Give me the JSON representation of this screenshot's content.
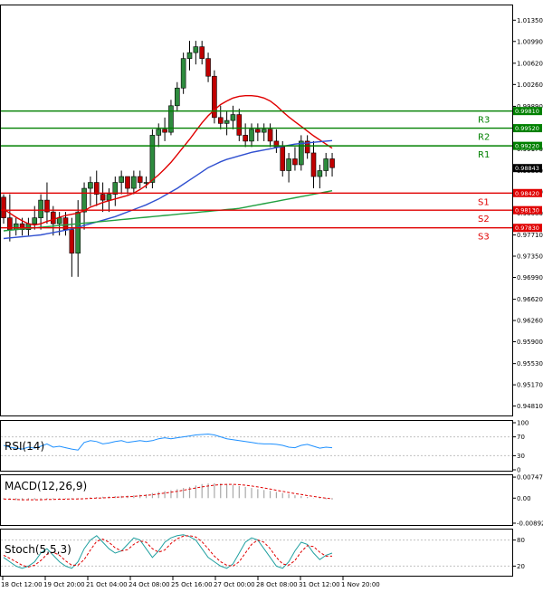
{
  "chart_data": [
    {
      "type": "candlestick",
      "title": "",
      "ylim": [
        0.9465,
        1.016
      ],
      "price_ticks": [
        "1.01350",
        "1.00990",
        "1.00620",
        "1.00260",
        "0.99890",
        "0.99170",
        "0.98800",
        "0.98440",
        "0.98080",
        "0.97710",
        "0.97350",
        "0.96990",
        "0.96620",
        "0.96260",
        "0.95900",
        "0.95530",
        "0.95170",
        "0.94810"
      ],
      "x_ticks": [
        "18 Oct 12:00",
        "19 Oct 20:00",
        "21 Oct 04:00",
        "24 Oct 08:00",
        "25 Oct 16:00",
        "27 Oct 00:00",
        "28 Oct 08:00",
        "31 Oct 12:00",
        "1 Nov 20:00"
      ],
      "current_price": {
        "label": "0.98843",
        "value": 0.98843
      },
      "levels": [
        {
          "name": "R3",
          "value": 0.9981,
          "label": "0.99810",
          "color": "#008000"
        },
        {
          "name": "R2",
          "value": 0.9952,
          "label": "0.99520",
          "color": "#008000"
        },
        {
          "name": "R1",
          "value": 0.9922,
          "label": "0.99220",
          "color": "#008000"
        },
        {
          "name": "S1",
          "value": 0.9842,
          "label": "0.98420",
          "color": "#e00000"
        },
        {
          "name": "S2",
          "value": 0.9813,
          "label": "0.98130",
          "color": "#e00000"
        },
        {
          "name": "S3",
          "value": 0.9783,
          "label": "0.97830",
          "color": "#e00000"
        }
      ],
      "candles": [
        [
          0.9835,
          0.984,
          0.979,
          0.98
        ],
        [
          0.98,
          0.984,
          0.976,
          0.978
        ],
        [
          0.978,
          0.98,
          0.977,
          0.979
        ],
        [
          0.979,
          0.98,
          0.977,
          0.978
        ],
        [
          0.978,
          0.98,
          0.977,
          0.979
        ],
        [
          0.979,
          0.982,
          0.978,
          0.98
        ],
        [
          0.98,
          0.984,
          0.978,
          0.983
        ],
        [
          0.983,
          0.986,
          0.979,
          0.981
        ],
        [
          0.981,
          0.982,
          0.977,
          0.979
        ],
        [
          0.979,
          0.981,
          0.977,
          0.98
        ],
        [
          0.98,
          0.981,
          0.977,
          0.978
        ],
        [
          0.978,
          0.98,
          0.97,
          0.974
        ],
        [
          0.974,
          0.983,
          0.97,
          0.981
        ],
        [
          0.981,
          0.986,
          0.978,
          0.985
        ],
        [
          0.985,
          0.987,
          0.982,
          0.986
        ],
        [
          0.986,
          0.988,
          0.982,
          0.984
        ],
        [
          0.984,
          0.986,
          0.981,
          0.983
        ],
        [
          0.983,
          0.985,
          0.981,
          0.984
        ],
        [
          0.984,
          0.987,
          0.982,
          0.986
        ],
        [
          0.986,
          0.988,
          0.984,
          0.987
        ],
        [
          0.987,
          0.987,
          0.984,
          0.985
        ],
        [
          0.985,
          0.988,
          0.984,
          0.987
        ],
        [
          0.987,
          0.988,
          0.985,
          0.986
        ],
        [
          0.986,
          0.987,
          0.985,
          0.986
        ],
        [
          0.986,
          0.995,
          0.985,
          0.994
        ],
        [
          0.994,
          0.996,
          0.992,
          0.995
        ],
        [
          0.995,
          0.997,
          0.993,
          0.9945
        ],
        [
          0.9945,
          1.0,
          0.994,
          0.999
        ],
        [
          0.999,
          1.003,
          0.998,
          1.002
        ],
        [
          1.002,
          1.008,
          1.001,
          1.007
        ],
        [
          1.007,
          1.01,
          1.005,
          1.008
        ],
        [
          1.008,
          1.01,
          1.006,
          1.009
        ],
        [
          1.009,
          1.01,
          1.006,
          1.007
        ],
        [
          1.007,
          1.008,
          1.003,
          1.004
        ],
        [
          1.004,
          1.005,
          0.996,
          0.997
        ],
        [
          0.997,
          0.999,
          0.995,
          0.996
        ],
        [
          0.996,
          0.998,
          0.994,
          0.9965
        ],
        [
          0.9965,
          0.999,
          0.995,
          0.9975
        ],
        [
          0.9975,
          0.9985,
          0.993,
          0.994
        ],
        [
          0.994,
          0.996,
          0.992,
          0.993
        ],
        [
          0.993,
          0.996,
          0.992,
          0.995
        ],
        [
          0.995,
          0.996,
          0.993,
          0.9945
        ],
        [
          0.9945,
          0.996,
          0.993,
          0.995
        ],
        [
          0.995,
          0.996,
          0.992,
          0.993
        ],
        [
          0.993,
          0.995,
          0.991,
          0.992
        ],
        [
          0.992,
          0.993,
          0.987,
          0.988
        ],
        [
          0.988,
          0.991,
          0.986,
          0.99
        ],
        [
          0.99,
          0.992,
          0.988,
          0.989
        ],
        [
          0.989,
          0.994,
          0.988,
          0.993
        ],
        [
          0.993,
          0.994,
          0.99,
          0.991
        ],
        [
          0.991,
          0.993,
          0.985,
          0.987
        ],
        [
          0.987,
          0.989,
          0.985,
          0.988
        ],
        [
          0.988,
          0.991,
          0.987,
          0.99
        ],
        [
          0.99,
          0.991,
          0.987,
          0.9885
        ]
      ],
      "series": [
        {
          "color": "#e00000",
          "values": [
            0.9815,
            0.9808,
            0.9801,
            0.9795,
            0.979,
            0.9788,
            0.979,
            0.9794,
            0.9797,
            0.9801,
            0.9804,
            0.9806,
            0.9808,
            0.9812,
            0.9818,
            0.9822,
            0.9826,
            0.9829,
            0.9832,
            0.9835,
            0.9838,
            0.9842,
            0.9848,
            0.9855,
            0.9864,
            0.9873,
            0.9883,
            0.9894,
            0.9907,
            0.992,
            0.9933,
            0.9947,
            0.9961,
            0.9973,
            0.9983,
            0.9992,
            0.9998,
            1.0003,
            1.0006,
            1.0007,
            1.0007,
            1.0006,
            1.0003,
            0.9998,
            0.999,
            0.998,
            0.9971,
            0.9963,
            0.9955,
            0.9947,
            0.9939,
            0.9932,
            0.9925,
            0.9918
          ]
        },
        {
          "color": "#3050d0",
          "values": [
            0.9765,
            0.9766,
            0.9767,
            0.9768,
            0.9769,
            0.977,
            0.9771,
            0.9773,
            0.9775,
            0.9777,
            0.9779,
            0.9781,
            0.9784,
            0.9787,
            0.979,
            0.9793,
            0.9796,
            0.9799,
            0.9802,
            0.9806,
            0.981,
            0.9814,
            0.9818,
            0.9822,
            0.9827,
            0.9832,
            0.9838,
            0.9844,
            0.985,
            0.9857,
            0.9864,
            0.9871,
            0.9878,
            0.9885,
            0.989,
            0.9895,
            0.9899,
            0.9902,
            0.9905,
            0.9908,
            0.9911,
            0.9913,
            0.9915,
            0.9917,
            0.9919,
            0.9921,
            0.9923,
            0.9925,
            0.9926,
            0.9927,
            0.9928,
            0.9929,
            0.993,
            0.9931
          ]
        },
        {
          "color": "#20a040",
          "values": [
            0.9778,
            0.9779,
            0.978,
            0.9781,
            0.9782,
            0.9783,
            0.9784,
            0.9785,
            0.9786,
            0.9787,
            0.9788,
            0.9789,
            0.979,
            0.9791,
            0.9792,
            0.9793,
            0.9794,
            0.9795,
            0.9796,
            0.9797,
            0.9798,
            0.9799,
            0.98,
            0.9801,
            0.9802,
            0.9803,
            0.9804,
            0.9805,
            0.9806,
            0.9807,
            0.9808,
            0.9809,
            0.981,
            0.9811,
            0.9812,
            0.9813,
            0.9814,
            0.9815,
            0.9816,
            0.9818,
            0.982,
            0.9822,
            0.9824,
            0.9826,
            0.9828,
            0.983,
            0.9832,
            0.9834,
            0.9836,
            0.9838,
            0.984,
            0.9842,
            0.9844,
            0.9846
          ]
        }
      ]
    },
    {
      "type": "line",
      "label": "RSI(14)",
      "ylim": [
        0,
        100
      ],
      "ticks": [
        "100",
        "70",
        "30",
        "0"
      ],
      "values": [
        52,
        48,
        46,
        44,
        48,
        46,
        50,
        55,
        48,
        50,
        47,
        44,
        42,
        58,
        62,
        60,
        55,
        57,
        60,
        62,
        58,
        60,
        62,
        60,
        62,
        66,
        68,
        66,
        68,
        70,
        72,
        74,
        75,
        76,
        74,
        70,
        66,
        64,
        62,
        60,
        58,
        56,
        55,
        55,
        54,
        52,
        48,
        47,
        52,
        54,
        50,
        46,
        48,
        47
      ]
    },
    {
      "type": "histogram+line",
      "label": "MACD(12,26,9)",
      "ylim": [
        -0.00925,
        0.0075
      ],
      "ticks": [
        "0.007478",
        "0.00",
        "-0.008922"
      ],
      "histogram": [
        -0.0004,
        -0.0006,
        -0.0007,
        -0.0008,
        -0.0007,
        -0.0006,
        -0.0005,
        -0.0004,
        -0.0003,
        -0.0002,
        -0.0002,
        -0.0003,
        -0.0002,
        0.0,
        0.0003,
        0.0004,
        0.0005,
        0.0006,
        0.0007,
        0.0008,
        0.0009,
        0.001,
        0.0012,
        0.0014,
        0.0018,
        0.0022,
        0.0025,
        0.0028,
        0.0032,
        0.0036,
        0.004,
        0.0045,
        0.005,
        0.0052,
        0.0053,
        0.0052,
        0.005,
        0.0047,
        0.0043,
        0.004,
        0.0036,
        0.0032,
        0.0029,
        0.0026,
        0.0022,
        0.0018,
        0.0014,
        0.001,
        0.0007,
        0.0004,
        0.0001,
        -0.0002,
        -0.0004,
        -0.0005
      ],
      "signal": [
        -0.0003,
        -0.0004,
        -0.0005,
        -0.0006,
        -0.0006,
        -0.0006,
        -0.0006,
        -0.0005,
        -0.0005,
        -0.0004,
        -0.0004,
        -0.0003,
        -0.0003,
        -0.0002,
        -0.0001,
        0.0,
        0.0001,
        0.0002,
        0.0003,
        0.0004,
        0.0005,
        0.0006,
        0.0008,
        0.001,
        0.0012,
        0.0015,
        0.0018,
        0.0021,
        0.0024,
        0.0028,
        0.0032,
        0.0036,
        0.004,
        0.0043,
        0.0046,
        0.0048,
        0.0049,
        0.0049,
        0.0048,
        0.0046,
        0.0043,
        0.004,
        0.0036,
        0.0032,
        0.0028,
        0.0024,
        0.002,
        0.0016,
        0.0013,
        0.0009,
        0.0006,
        0.0003,
        0.0,
        -0.0002
      ]
    },
    {
      "type": "line",
      "label": "Stoch(5,5,3)",
      "ylim": [
        0,
        100
      ],
      "ticks": [
        "80",
        "20"
      ],
      "k": [
        40,
        30,
        20,
        15,
        20,
        30,
        50,
        60,
        45,
        30,
        20,
        15,
        30,
        60,
        80,
        90,
        75,
        60,
        50,
        55,
        70,
        85,
        80,
        60,
        40,
        55,
        75,
        85,
        90,
        92,
        88,
        80,
        60,
        40,
        30,
        20,
        15,
        25,
        50,
        75,
        85,
        80,
        60,
        40,
        20,
        15,
        30,
        55,
        75,
        70,
        50,
        35,
        45,
        50
      ],
      "d": [
        45,
        38,
        30,
        22,
        18,
        22,
        33,
        47,
        52,
        45,
        32,
        22,
        22,
        35,
        57,
        77,
        82,
        75,
        62,
        55,
        58,
        70,
        78,
        75,
        60,
        52,
        57,
        72,
        83,
        89,
        90,
        87,
        76,
        60,
        43,
        30,
        22,
        20,
        30,
        50,
        70,
        80,
        75,
        60,
        40,
        25,
        22,
        33,
        53,
        67,
        65,
        52,
        43,
        43
      ]
    }
  ]
}
